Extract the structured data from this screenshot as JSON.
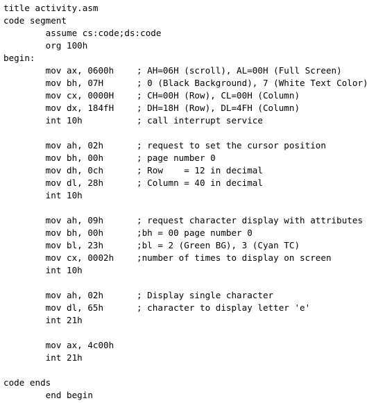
{
  "lines": [
    {
      "code": "title activity.asm",
      "comment": ""
    },
    {
      "code": "code segment",
      "comment": ""
    },
    {
      "code": "        assume cs:code;ds:code",
      "comment": ""
    },
    {
      "code": "        org 100h",
      "comment": ""
    },
    {
      "code": "begin:",
      "comment": ""
    },
    {
      "code": "        mov ax, 0600h",
      "comment": "; AH=06H (scroll), AL=00H (Full Screen)"
    },
    {
      "code": "        mov bh, 07H",
      "comment": "; 0 (Black Background), 7 (White Text Color)"
    },
    {
      "code": "        mov cx, 0000H",
      "comment": "; CH=00H (Row), CL=00H (Column)"
    },
    {
      "code": "        mov dx, 184fH",
      "comment": "; DH=18H (Row), DL=4FH (Column)"
    },
    {
      "code": "        int 10h",
      "comment": "; call interrupt service"
    },
    {
      "code": "",
      "comment": ""
    },
    {
      "code": "        mov ah, 02h",
      "comment": "; request to set the cursor position"
    },
    {
      "code": "        mov bh, 00h",
      "comment": "; page number 0"
    },
    {
      "code": "        mov dh, 0ch",
      "comment": "; Row    = 12 in decimal"
    },
    {
      "code": "        mov dl, 28h",
      "comment": "; Column = 40 in decimal"
    },
    {
      "code": "        int 10h",
      "comment": ""
    },
    {
      "code": "",
      "comment": ""
    },
    {
      "code": "        mov ah, 09h",
      "comment": "; request character display with attributes"
    },
    {
      "code": "        mov bh, 00h",
      "comment": ";bh = 00 page number 0"
    },
    {
      "code": "        mov bl, 23h",
      "comment": ";bl = 2 (Green BG), 3 (Cyan TC)"
    },
    {
      "code": "        mov cx, 0002h",
      "comment": ";number of times to display on screen"
    },
    {
      "code": "        int 10h",
      "comment": ""
    },
    {
      "code": "",
      "comment": ""
    },
    {
      "code": "        mov ah, 02h",
      "comment": "; Display single character"
    },
    {
      "code": "        mov dl, 65h",
      "comment": "; character to display letter 'e'"
    },
    {
      "code": "        int 21h",
      "comment": ""
    },
    {
      "code": "",
      "comment": ""
    },
    {
      "code": "        mov ax, 4c00h",
      "comment": ""
    },
    {
      "code": "        int 21h",
      "comment": ""
    },
    {
      "code": "",
      "comment": ""
    },
    {
      "code": "code ends",
      "comment": ""
    },
    {
      "code": "        end begin",
      "comment": ""
    }
  ]
}
